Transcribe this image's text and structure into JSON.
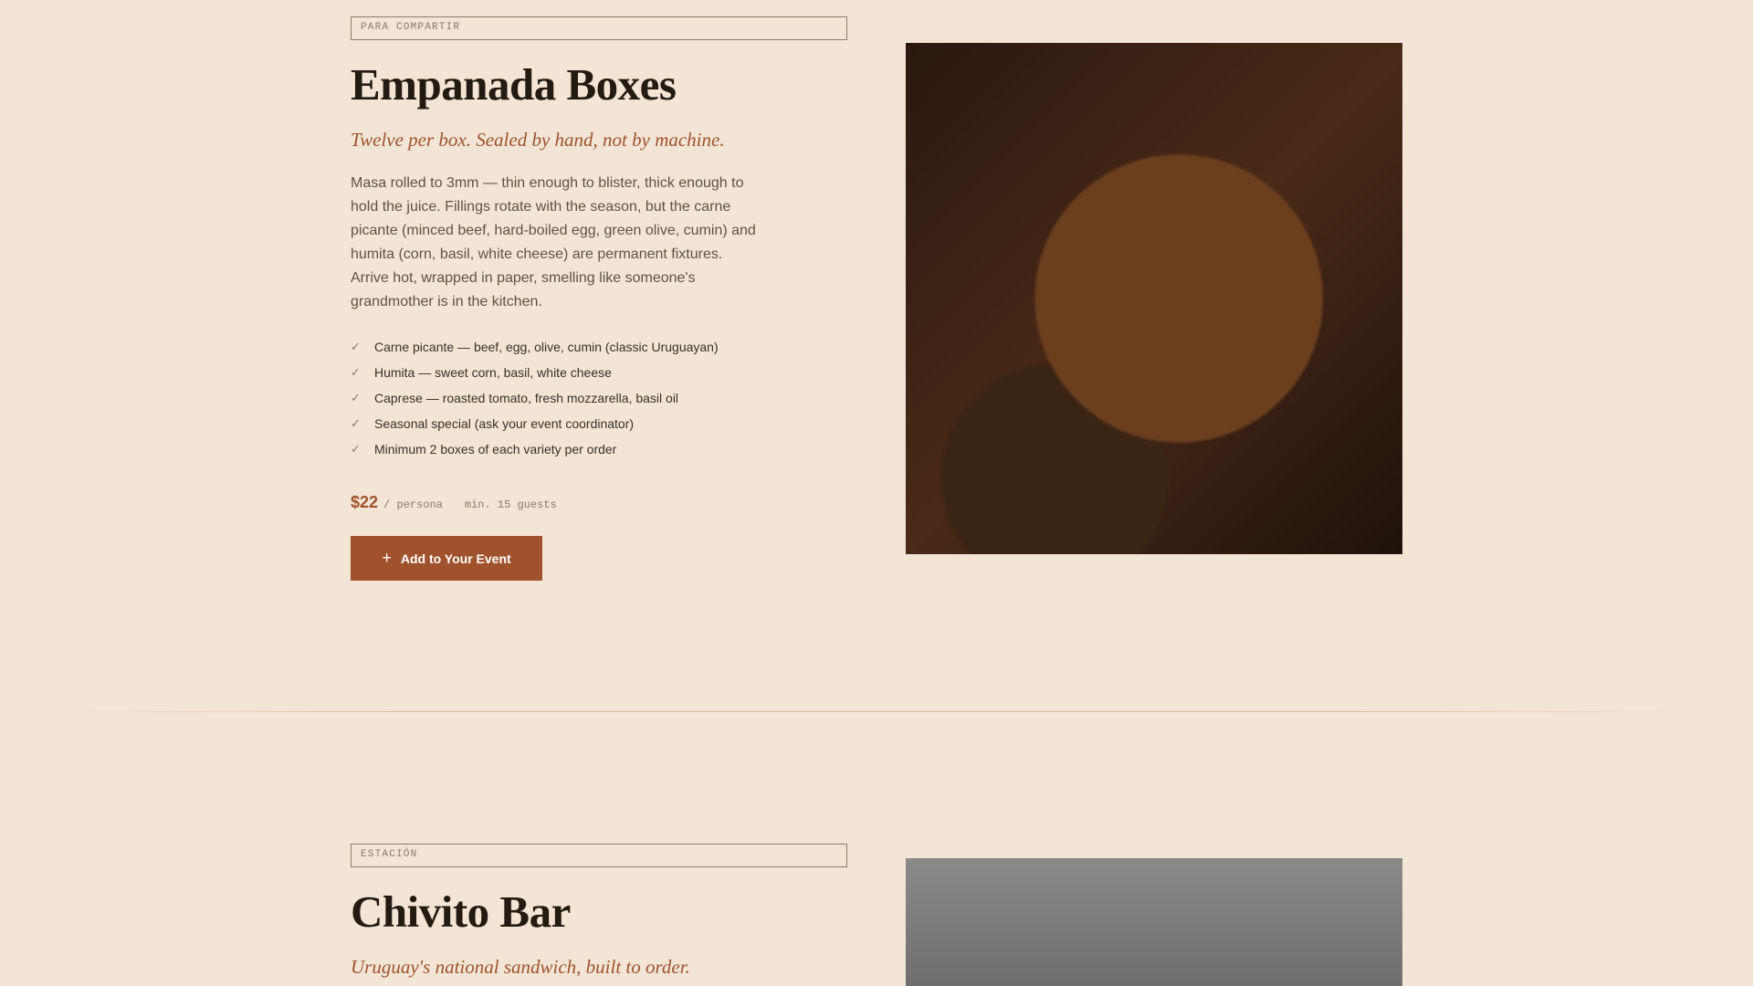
{
  "empanada": {
    "tag": "PARA COMPARTIR",
    "title": "Empanada Boxes",
    "tagline": "Twelve per box. Sealed by hand, not by machine.",
    "description": "Masa rolled to 3mm — thin enough to blister, thick enough to hold the juice. Fillings rotate with the season, but the carne picante (minced beef, hard-boiled egg, green olive, cumin) and humita (corn, basil, white cheese) are permanent fixtures. Arrive hot, wrapped in paper, smelling like someone's grandmother is in the kitchen.",
    "features": [
      "Carne picante — beef, egg, olive, cumin (classic Uruguayan)",
      "Humita — sweet corn, basil, white cheese",
      "Caprese — roasted tomato, fresh mozzarella, basil oil",
      "Seasonal special (ask your event coordinator)",
      "Minimum 2 boxes of each variety per order"
    ],
    "price": "$22",
    "unit": "/ persona",
    "min_guests": "min. 15 guests",
    "cta_label": "Add to Your Event",
    "cta_icon": "plus-icon"
  },
  "chivito": {
    "tag": "ESTACIÓN",
    "title": "Chivito Bar",
    "tagline": "Uruguay's national sandwich, built to order."
  },
  "colors": {
    "background": "#f2e5d5",
    "accent": "#a0522d",
    "text": "#2b2118"
  }
}
